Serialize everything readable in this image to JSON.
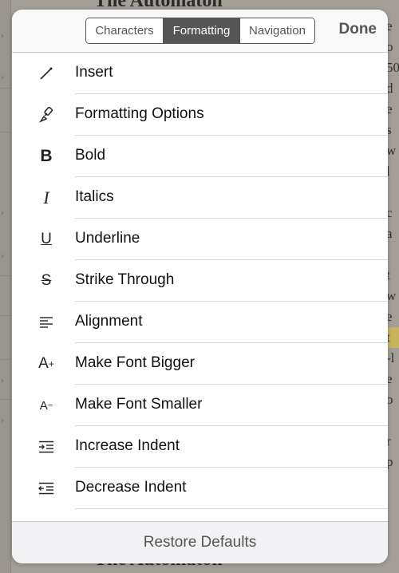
{
  "background": {
    "title": "The Automaton",
    "right_col": [
      "e",
      "o",
      "50",
      "d",
      "e",
      "s",
      "w",
      "l",
      "",
      "c",
      "a",
      "",
      "t",
      "w",
      "e",
      "t",
      "-l",
      "e",
      "o",
      "",
      "r",
      "p"
    ]
  },
  "header": {
    "tabs": [
      {
        "label": "Characters",
        "active": false
      },
      {
        "label": "Formatting",
        "active": true
      },
      {
        "label": "Navigation",
        "active": false
      }
    ],
    "done_label": "Done"
  },
  "items": [
    {
      "label": "Insert",
      "icon": "pencil-icon"
    },
    {
      "label": "Formatting Options",
      "icon": "brush-icon"
    },
    {
      "label": "Bold",
      "icon": "bold-icon"
    },
    {
      "label": "Italics",
      "icon": "italic-icon"
    },
    {
      "label": "Underline",
      "icon": "underline-icon"
    },
    {
      "label": "Strike Through",
      "icon": "strikethrough-icon"
    },
    {
      "label": "Alignment",
      "icon": "align-left-icon"
    },
    {
      "label": "Make Font Bigger",
      "icon": "font-bigger-icon"
    },
    {
      "label": "Make Font Smaller",
      "icon": "font-smaller-icon"
    },
    {
      "label": "Increase Indent",
      "icon": "indent-increase-icon"
    },
    {
      "label": "Decrease Indent",
      "icon": "indent-decrease-icon"
    },
    {
      "label": "",
      "icon": "box-icon"
    }
  ],
  "footer": {
    "restore_label": "Restore Defaults"
  },
  "colors": {
    "accent": "#555555",
    "panel": "#ffffff",
    "separator": "#d9d9dd"
  }
}
